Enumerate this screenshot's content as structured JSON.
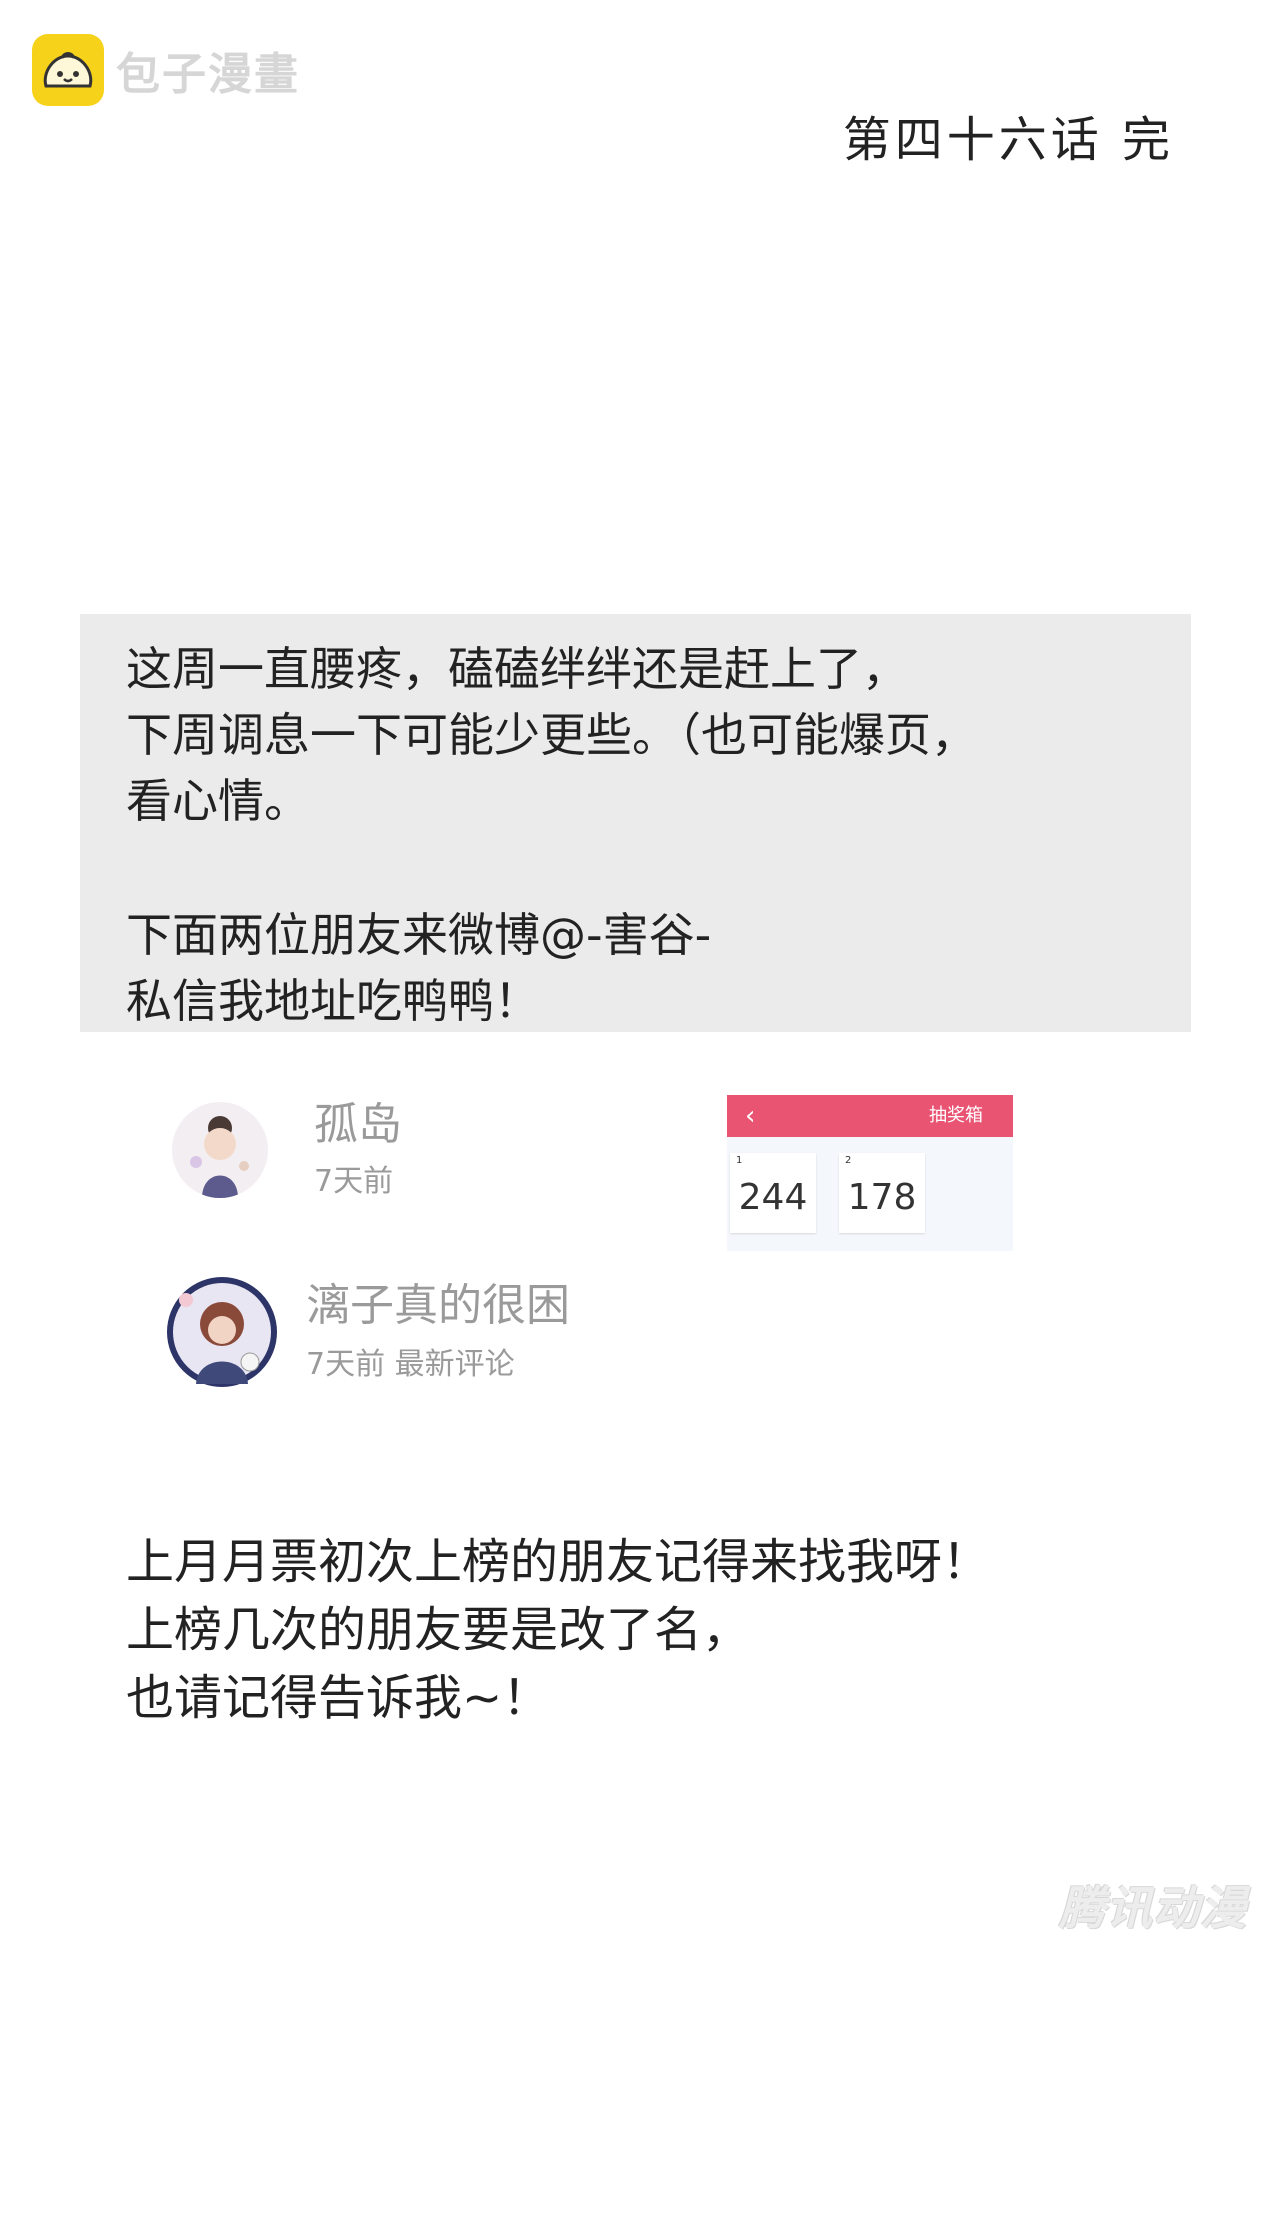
{
  "logo": {
    "text": "包子漫畫",
    "icon": "bun-face-icon"
  },
  "chapter_end": "第四十六话  完",
  "note": {
    "lines": [
      "这周一直腰疼，磕磕绊绊还是赶上了，",
      "下周调息一下可能少更些。（也可能爆页，",
      "看心情。",
      "下面两位朋友来微博@-害谷-",
      "私信我地址吃鸭鸭！"
    ]
  },
  "comments": [
    {
      "name": "孤岛",
      "meta": "7天前"
    },
    {
      "name": "漓子真的很困",
      "meta": "7天前 最新评论"
    }
  ],
  "lottery": {
    "title": "抽奖箱",
    "back_icon": "chevron-left-icon",
    "header_color": "#e95473",
    "tickets": [
      {
        "rank": "1",
        "number": "244"
      },
      {
        "rank": "2",
        "number": "178"
      }
    ]
  },
  "bottom_text": [
    "上月月票初次上榜的朋友记得来找我呀！",
    "上榜几次的朋友要是改了名，",
    "也请记得告诉我~！"
  ],
  "watermark": "腾讯动漫"
}
